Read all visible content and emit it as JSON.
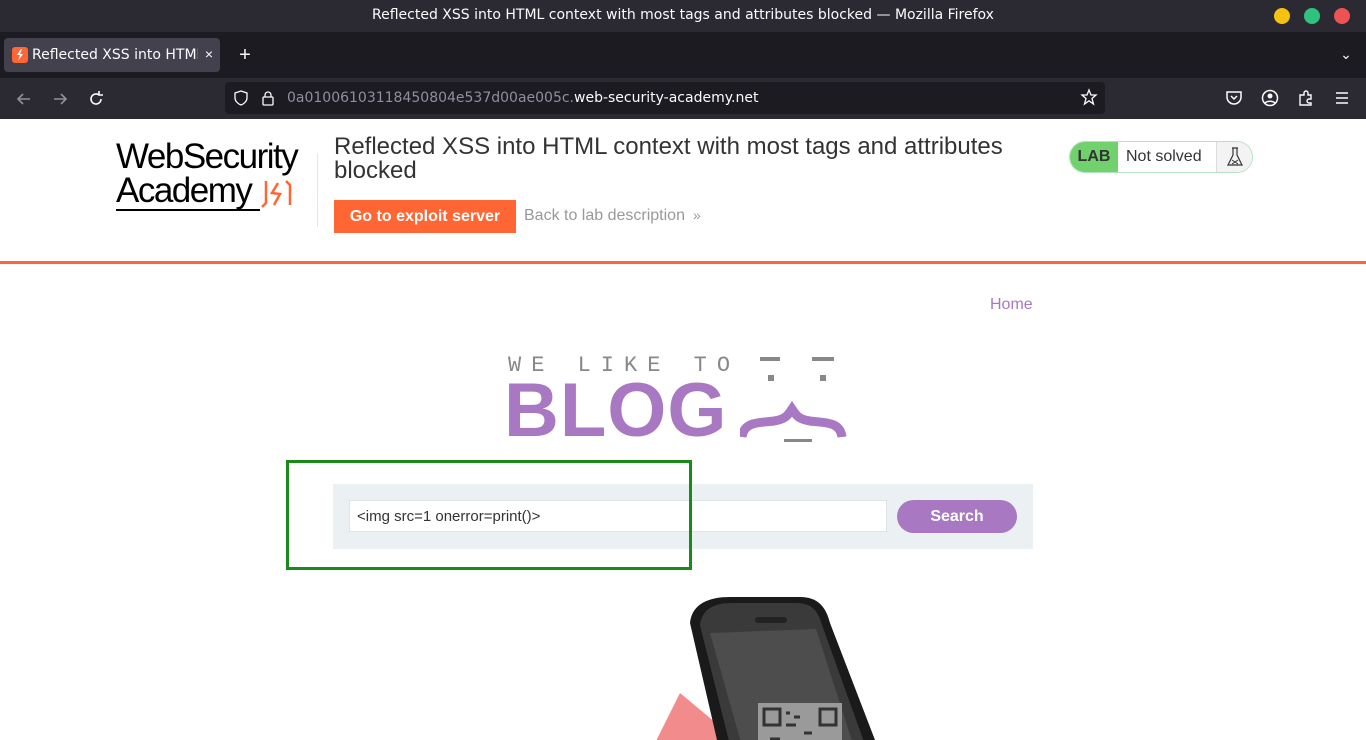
{
  "window": {
    "title": "Reflected XSS into HTML context with most tags and attributes blocked — Mozilla Firefox"
  },
  "tabs": [
    {
      "label": "Reflected XSS into HTML",
      "close": "×"
    }
  ],
  "tabstrip": {
    "new_tab": "+",
    "list_all": "⌄"
  },
  "navbar": {
    "url_subdomain": "0a01006103118450804e537d00ae005c.",
    "url_domain": "web-security-academy.net"
  },
  "header": {
    "logo_line1": "WebSecurity",
    "logo_line2": "Academy",
    "lab_title": "Reflected XSS into HTML context with most tags and attributes blocked",
    "exploit_button": "Go to exploit server",
    "back_link": "Back to lab description",
    "back_chevron": "»",
    "badge_label": "LAB",
    "badge_status": "Not solved"
  },
  "blog": {
    "nav_home": "Home",
    "logo_small": "WE LIKE TO",
    "logo_big": "BLOG",
    "search_value": "<img src=1 onerror=print()>",
    "search_button": "Search"
  },
  "colors": {
    "brand_orange": "#ff6633",
    "blog_purple": "#a878c2",
    "lab_green": "#70d16d",
    "highlight_green": "#1a8a1a"
  }
}
